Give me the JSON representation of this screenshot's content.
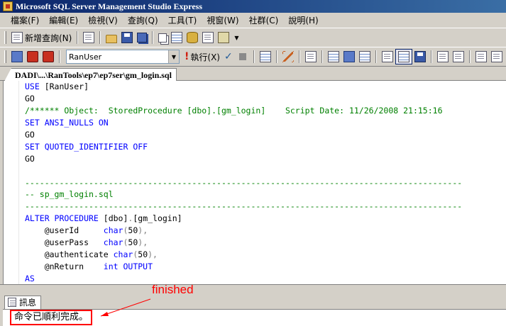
{
  "window": {
    "title": "Microsoft SQL Server Management Studio Express"
  },
  "menu": [
    "檔案(F)",
    "編輯(E)",
    "檢視(V)",
    "查詢(Q)",
    "工具(T)",
    "視窗(W)",
    "社群(C)",
    "說明(H)"
  ],
  "toolbar": {
    "new_query_label": "新增查詢(N)",
    "database_selected": "RanUser",
    "execute_label": "執行(X)"
  },
  "document_tab": {
    "title": "DADI\\...\\RanTools\\ep7\\ep7ser\\gm_login.sql"
  },
  "code_lines": [
    [
      {
        "t": "USE ",
        "c": "kw"
      },
      {
        "t": "[RanUser]",
        "c": "plain"
      }
    ],
    [
      {
        "t": "GO",
        "c": "plain"
      }
    ],
    [
      {
        "t": "/****** Object:  StoredProcedure [dbo].[gm_login]    Script Date: 11/26/2008 21:15:16",
        "c": "cm"
      }
    ],
    [
      {
        "t": "SET ANSI_NULLS ON",
        "c": "kw"
      }
    ],
    [
      {
        "t": "GO",
        "c": "plain"
      }
    ],
    [
      {
        "t": "SET QUOTED_IDENTIFIER OFF",
        "c": "kw"
      }
    ],
    [
      {
        "t": "GO",
        "c": "plain"
      }
    ],
    [],
    [
      {
        "t": "-----------------------------------------------------------------------------------------",
        "c": "cm"
      }
    ],
    [
      {
        "t": "-- sp_gm_login.sql",
        "c": "cm"
      }
    ],
    [
      {
        "t": "-----------------------------------------------------------------------------------------",
        "c": "cm"
      }
    ],
    [
      {
        "t": "ALTER PROCEDURE ",
        "c": "kw"
      },
      {
        "t": "[dbo]",
        "c": "plain"
      },
      {
        "t": ".",
        "c": "op"
      },
      {
        "t": "[gm_login]",
        "c": "plain"
      }
    ],
    [
      {
        "t": "    @userId     ",
        "c": "plain"
      },
      {
        "t": "char",
        "c": "kw"
      },
      {
        "t": "(",
        "c": "op"
      },
      {
        "t": "50",
        "c": "plain"
      },
      {
        "t": "),",
        "c": "op"
      }
    ],
    [
      {
        "t": "    @userPass   ",
        "c": "plain"
      },
      {
        "t": "char",
        "c": "kw"
      },
      {
        "t": "(",
        "c": "op"
      },
      {
        "t": "50",
        "c": "plain"
      },
      {
        "t": "),",
        "c": "op"
      }
    ],
    [
      {
        "t": "    @authenticate ",
        "c": "plain"
      },
      {
        "t": "char",
        "c": "kw"
      },
      {
        "t": "(",
        "c": "op"
      },
      {
        "t": "50",
        "c": "plain"
      },
      {
        "t": "),",
        "c": "op"
      }
    ],
    [
      {
        "t": "    @nReturn    ",
        "c": "plain"
      },
      {
        "t": "int OUTPUT",
        "c": "kw"
      }
    ],
    [
      {
        "t": "AS",
        "c": "kw"
      }
    ]
  ],
  "results": {
    "tab_label": "訊息",
    "message": "命令已順利完成。"
  },
  "annotation": {
    "text": "finished",
    "color": "#ff0000"
  }
}
